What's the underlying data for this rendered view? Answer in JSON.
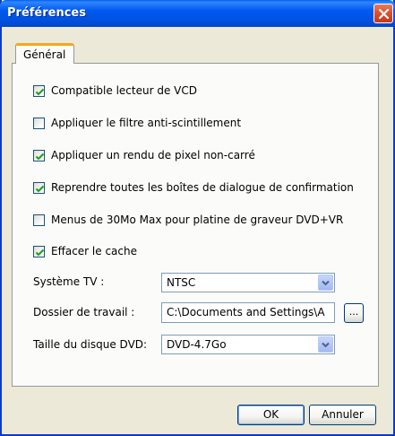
{
  "window": {
    "title": "Préférences"
  },
  "tabs": [
    {
      "label": "Général"
    }
  ],
  "options": [
    {
      "label": "Compatible lecteur de VCD",
      "checked": true
    },
    {
      "label": "Appliquer le filtre anti-scintillement",
      "checked": false
    },
    {
      "label": "Appliquer un rendu de pixel non-carré",
      "checked": true
    },
    {
      "label": "Reprendre toutes les boîtes de dialogue de confirmation",
      "checked": true
    },
    {
      "label": "Menus de 30Mo Max pour platine de graveur DVD+VR",
      "checked": false
    },
    {
      "label": "Effacer le cache",
      "checked": true
    }
  ],
  "fields": {
    "tv_system": {
      "label": "Système TV :",
      "value": "NTSC"
    },
    "work_folder": {
      "label": "Dossier de travail :",
      "value": "C:\\Documents and Settings\\A",
      "browse_label": "..."
    },
    "dvd_size": {
      "label": "Taille du disque DVD:",
      "value": "DVD-4.7Go"
    }
  },
  "buttons": {
    "ok": "OK",
    "cancel": "Annuler"
  },
  "colors": {
    "titlebar": "#0054e3",
    "tab_highlight": "#f4a71f",
    "checkmark": "#21a121",
    "close": "#d9502c"
  }
}
